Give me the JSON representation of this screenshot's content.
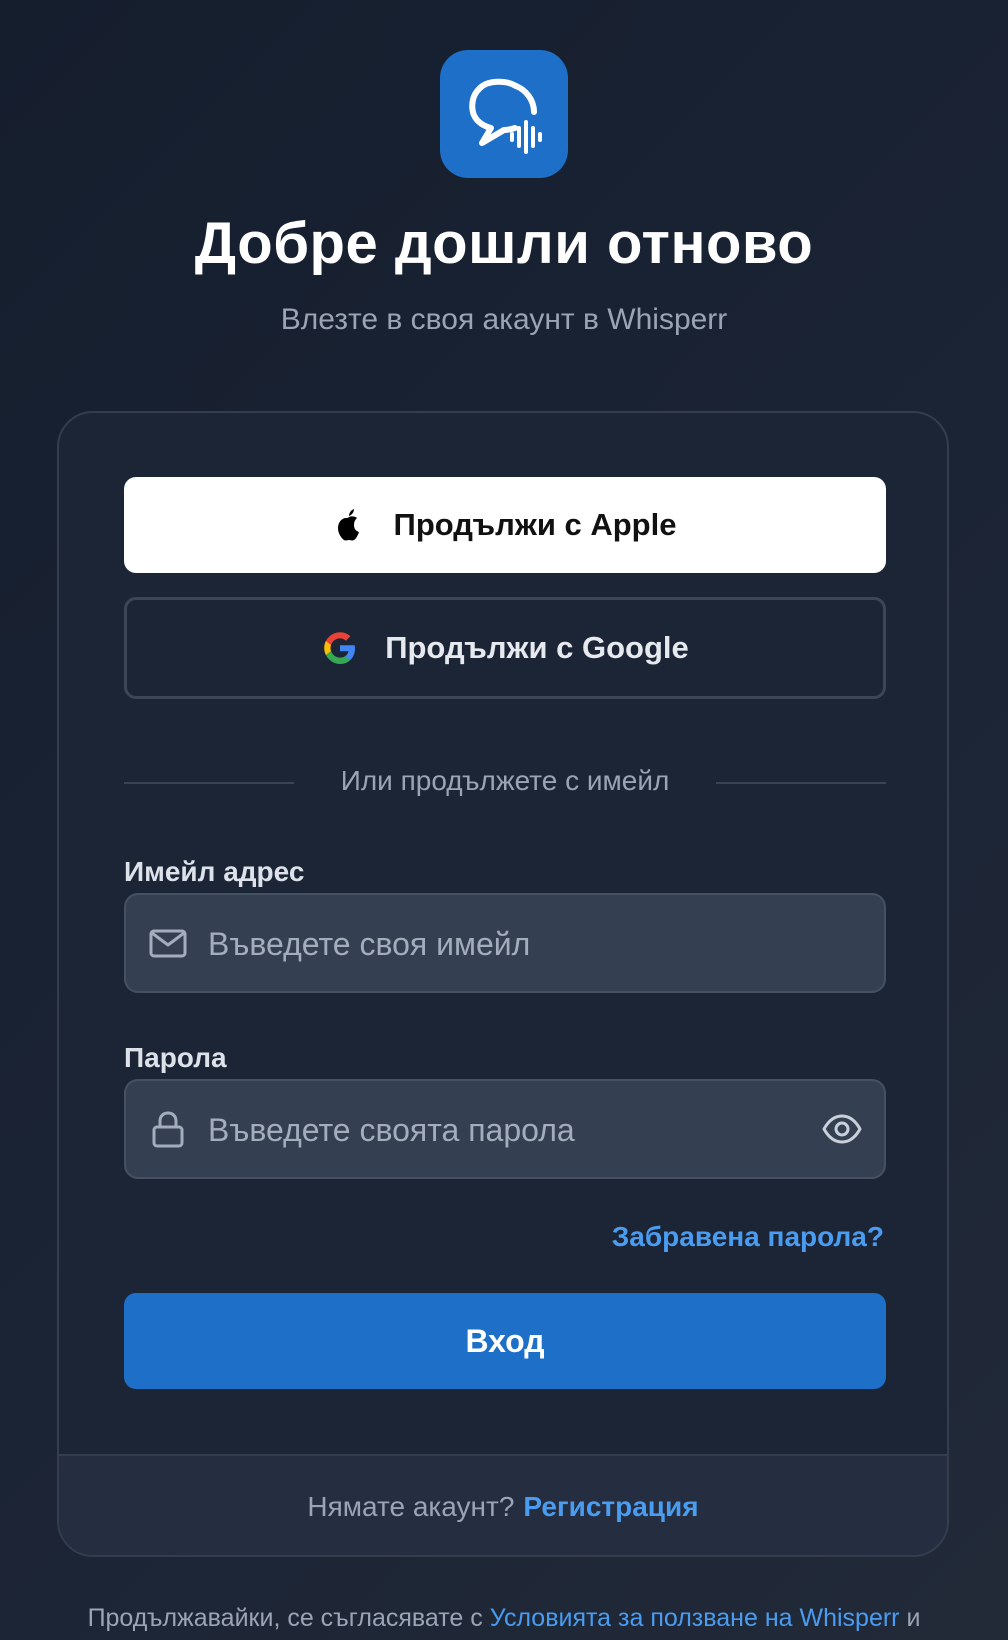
{
  "app": {
    "logo_icon": "chat-bubble-soundwave-icon",
    "brand_color": "#1d6fc8"
  },
  "header": {
    "title": "Добре дошли отново",
    "subtitle": "Влезте в своя акаунт в Whisperr"
  },
  "auth": {
    "apple_label": "Продължи с Apple",
    "apple_icon": "apple-icon",
    "google_label": "Продължи с Google",
    "google_icon": "google-icon",
    "divider_text": "Или продължете с имейл"
  },
  "form": {
    "email_label": "Имейл адрес",
    "email_placeholder": "Въведете своя имейл",
    "email_value": "",
    "email_icon": "mail-icon",
    "password_label": "Парола",
    "password_placeholder": "Въведете своята парола",
    "password_value": "",
    "password_icon": "lock-icon",
    "visibility_icon": "eye-icon",
    "forgot_label": "Забравена парола?",
    "submit_label": "Вход"
  },
  "footer": {
    "no_account_text": "Нямате акаунт?",
    "signup_label": "Регистрация"
  },
  "legal": {
    "prefix": "Продължавайки, се съгласявате с ",
    "terms_link": "Условията за ползване на Whisperr",
    "suffix": " и"
  },
  "colors": {
    "accent": "#1d6fc8",
    "link": "#4a9cf0",
    "background": "#1b2435",
    "card": "#1c2536"
  }
}
